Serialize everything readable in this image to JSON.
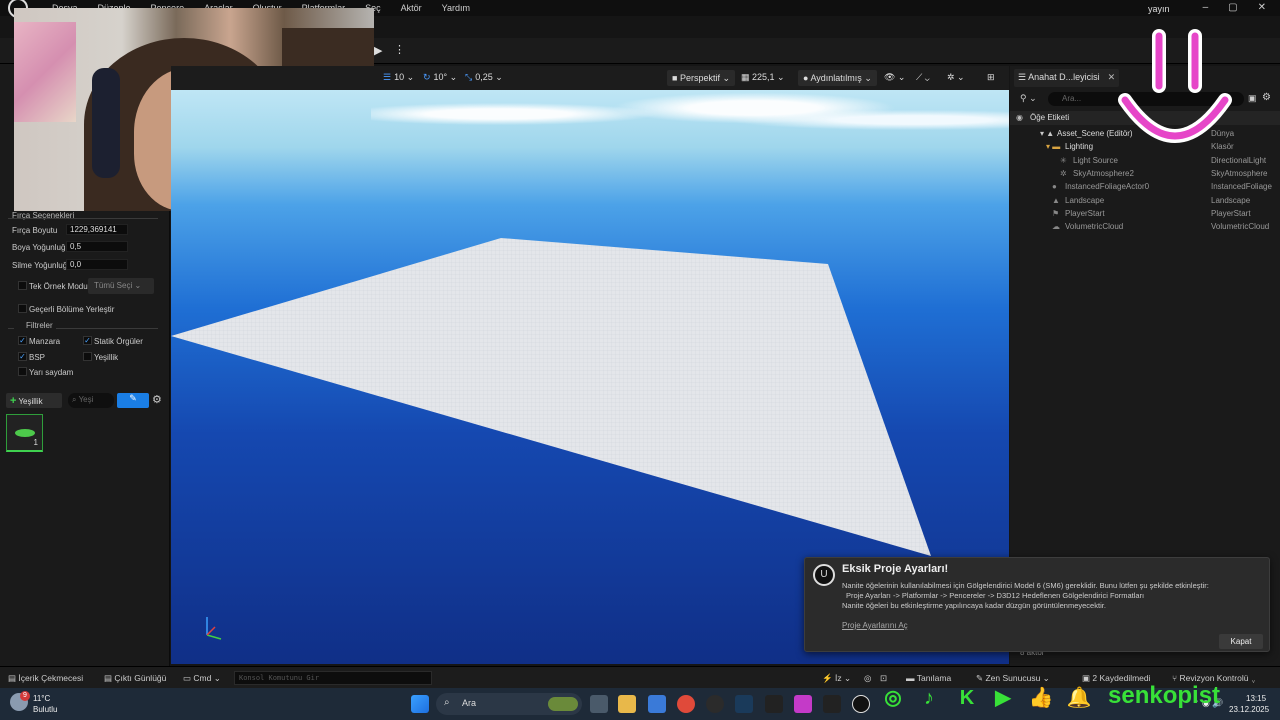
{
  "menubar": {
    "items": [
      "Dosya",
      "Düzenle",
      "Pencere",
      "Araçlar",
      "Oluştur",
      "Platformlar",
      "Seç",
      "Aktör",
      "Yardım"
    ],
    "window_title": "yayın",
    "win_buttons": [
      "–",
      "▢",
      "✕"
    ]
  },
  "left_panel": {
    "brush_section": "Fırça Seçenekleri",
    "brush_size_label": "Fırça Boyutu",
    "brush_size_value": "1229,369141",
    "paint_density_label": "Boya Yoğunluğ",
    "paint_density_value": "0,5",
    "erase_density_label": "Silme Yoğunluğ",
    "erase_density_value": "0,0",
    "single_instance_label": "Tek Örnek Modu",
    "select_all_label": "Tümü Seçi",
    "place_in_level_label": "Geçerli Bölüme Yerleştir",
    "filters_section": "Filtreler",
    "filters": [
      {
        "label": "Manzara",
        "checked": true
      },
      {
        "label": "Statik Örgüler",
        "checked": true
      },
      {
        "label": "BSP",
        "checked": true
      },
      {
        "label": "Yeşillik",
        "checked": false
      },
      {
        "label": "Yarı saydam",
        "checked": false
      }
    ],
    "add_foliage_label": "Yeşillik",
    "search_placeholder": "Yeşi",
    "foliage_count": "1"
  },
  "viewport": {
    "grid_snap": "10",
    "rotation_snap": "10°",
    "scale_snap": "0,25",
    "view_mode": "Perspektif",
    "fov": "225,1",
    "lighting": "Aydınlatılmış",
    "axis_label": "Z Y"
  },
  "outliner": {
    "tab_title": "Anahat D...leyicisi",
    "search_placeholder": "Ara...",
    "header_label": "Öğe Etiketi",
    "rows": [
      {
        "name": "Asset_Scene (Editör)",
        "type": "Dünya"
      },
      {
        "name": "Lighting",
        "type": "Klasör"
      },
      {
        "name": "Light Source",
        "type": "DirectionalLight"
      },
      {
        "name": "SkyAtmosphere2",
        "type": "SkyAtmosphere"
      },
      {
        "name": "InstancedFoliageActor0",
        "type": "InstancedFoliage"
      },
      {
        "name": "Landscape",
        "type": "Landscape"
      },
      {
        "name": "PlayerStart",
        "type": "PlayerStart"
      },
      {
        "name": "VolumetricCloud",
        "type": "VolumetricCloud"
      }
    ],
    "status": "8 aktör"
  },
  "notification": {
    "title": "Eksik Proje Ayarları!",
    "line1": "Nanite öğelerinin kullanılabilmesi için Gölgelendirici Model 6 (SM6) gereklidir. Bunu lütfen şu şekilde etkinleştir:",
    "line2": "Proje Ayarları -> Platformlar -> Pencereler -> D3D12 Hedeflenen Gölgelendirici Formatları",
    "line3": "Nanite öğeleri bu etkinleştirme yapılıncaya kadar düzgün görüntülenmeyecektir.",
    "link": "Proje Ayarlarını Aç",
    "close_label": "Kapat"
  },
  "bottom_bar": {
    "content_drawer": "İçerik Çekmecesi",
    "output_log": "Çıktı Günlüğü",
    "cmd": "Cmd",
    "console_placeholder": "Konsol Komutunu Gir",
    "trace": "İz",
    "diagnostics": "Tanılama",
    "zen_server": "Zen Sunucusu",
    "saved": "2 Kaydedilmedi",
    "revision": "Revizyon Kontrolü"
  },
  "taskbar": {
    "weather_temp": "11°C",
    "weather_desc": "Bulutlu",
    "weather_badge": "9",
    "search_label": "Ara",
    "time": "13:15",
    "date": "23.12.2025"
  },
  "overlay": {
    "brand_name": "senkopist",
    "accent": "#38e138",
    "smiley_color": "#e646c8"
  }
}
